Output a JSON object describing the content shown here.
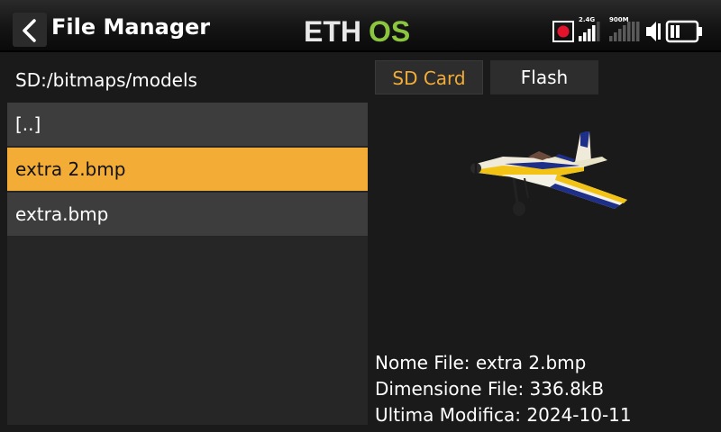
{
  "header": {
    "title": "File Manager",
    "logo_text_left": "ETH",
    "logo_text_right": "OS",
    "logo_colors": {
      "left": "#e8e8e8",
      "right": "#8cc63f"
    },
    "signal_labels": {
      "band1": "2.4G",
      "band2": "900M"
    },
    "icons": [
      "back-chevron-icon",
      "record-icon",
      "signal-2-4g-icon",
      "signal-900m-icon",
      "speaker-icon",
      "battery-icon"
    ]
  },
  "browser": {
    "path": "SD:/bitmaps/models",
    "files": [
      "[..]",
      "extra 2.bmp",
      "extra.bmp"
    ],
    "selected_index": 1
  },
  "tabs": {
    "sd_card": "SD Card",
    "flash": "Flash",
    "active": "sd_card"
  },
  "details": {
    "name_label": "Nome File:",
    "name_value": "extra 2.bmp",
    "size_label": "Dimensione File:",
    "size_value": "336.8kB",
    "modified_label": "Ultima Modifica:",
    "modified_value": "2024-10-11"
  },
  "colors": {
    "accent": "#f3ad36",
    "background": "#1a1a1a",
    "row": "#3d3d3d",
    "record": "#e3132b"
  }
}
